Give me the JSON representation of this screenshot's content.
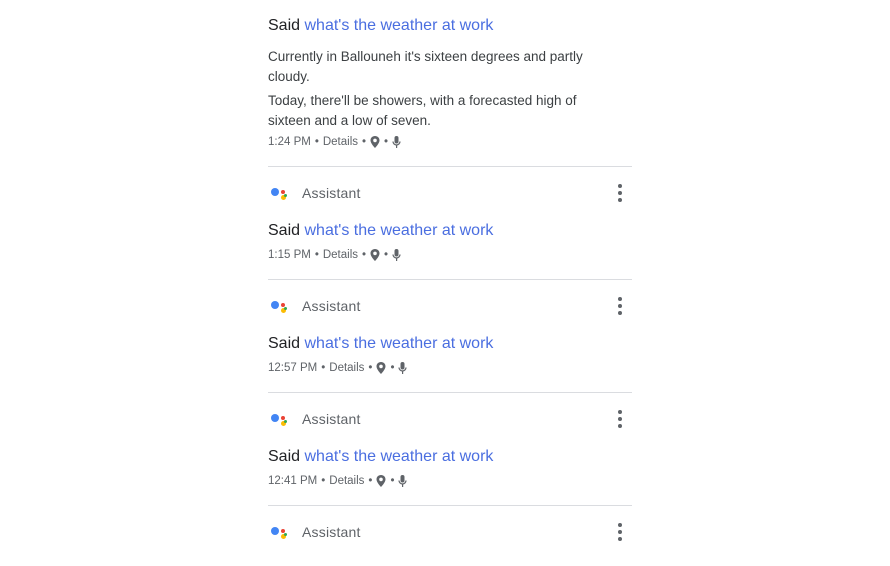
{
  "entries": [
    {
      "said_prefix": "Said",
      "query": "what's the weather at work",
      "responses": [
        "Currently in Ballouneh it's sixteen degrees and partly cloudy.",
        "Today, there'll be showers, with a forecasted high of sixteen and a low of seven."
      ],
      "time": "1:24 PM",
      "details": "Details",
      "separator": "•"
    },
    {
      "app": "Assistant",
      "said_prefix": "Said",
      "query": "what's the weather at work",
      "time": "1:15 PM",
      "details": "Details",
      "separator": "•"
    },
    {
      "app": "Assistant",
      "said_prefix": "Said",
      "query": "what's the weather at work",
      "time": "12:57 PM",
      "details": "Details",
      "separator": "•"
    },
    {
      "app": "Assistant",
      "said_prefix": "Said",
      "query": "what's the weather at work",
      "time": "12:41 PM",
      "details": "Details",
      "separator": "•"
    },
    {
      "app": "Assistant"
    }
  ],
  "icons": {
    "location": "location-pin-icon",
    "microphone": "microphone-icon",
    "menu": "more-vert-icon",
    "assistant": "google-assistant-logo"
  },
  "colors": {
    "query_link": "#4a6ee0",
    "divider": "#dadce0",
    "assistant_blue": "#4285f4",
    "assistant_red": "#ea4335",
    "assistant_yellow": "#fbbc04",
    "assistant_green": "#34a853"
  }
}
